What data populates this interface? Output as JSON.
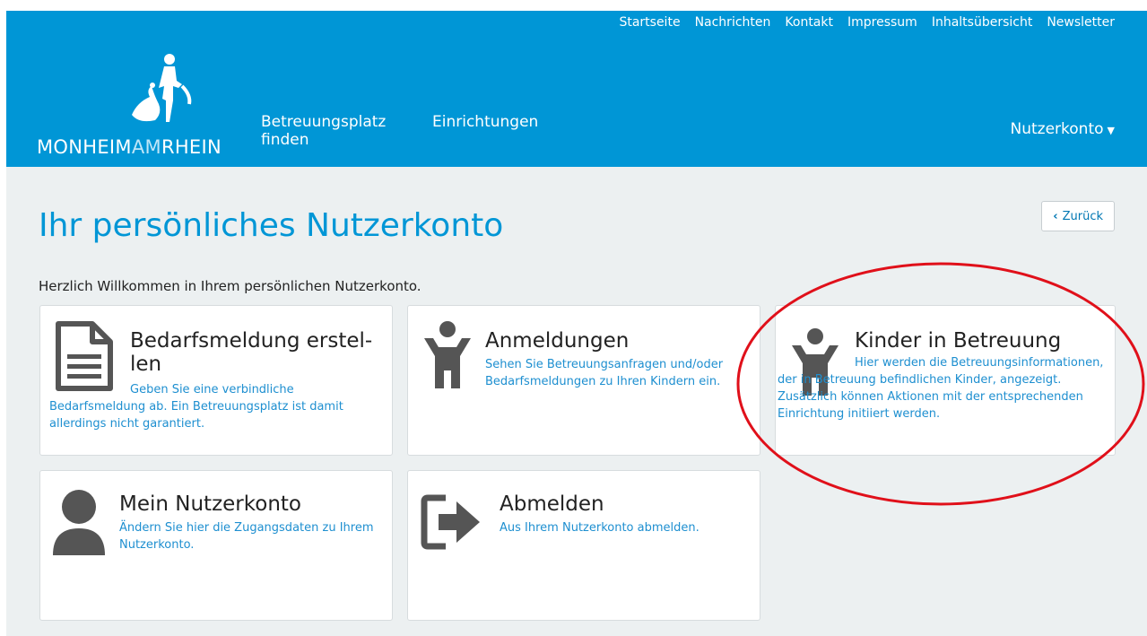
{
  "topnav": [
    "Startseite",
    "Nachrichten",
    "Kontakt",
    "Impressum",
    "Inhaltsübersicht",
    "Newsletter"
  ],
  "logo": {
    "part1": "MONHEIM",
    "part2": "AM",
    "part3": "RHEIN"
  },
  "mainnav": {
    "item1": "Betreuungsplatz finden",
    "item2": "Einrichtungen"
  },
  "account": {
    "label": "Nutzerkonto"
  },
  "page": {
    "title": "Ihr persönliches Nutzerkonto",
    "back": "Zurück",
    "welcome": "Herzlich Willkommen in Ihrem persönlichen Nutzerkonto."
  },
  "cards": [
    {
      "title": "Bedarfsmeldung erstel-\nlen",
      "desc": "Geben Sie eine verbindliche Bedarfsmeldung ab. Ein Betreuungsplatz ist damit allerdings nicht garantiert.",
      "icon": "document-icon"
    },
    {
      "title": "Anmeldungen",
      "desc": "Sehen Sie Betreuungsanfragen und/oder Bedarfsmeldungen zu Ihren Kindern ein.",
      "icon": "child-icon"
    },
    {
      "title": "Kinder in Betreuung",
      "desc": "Hier werden die Betreuungsinformationen, der in Betreuung befindlichen Kinder, angezeigt. Zusätzlich können Aktionen mit der entsprechenden Einrichtung initiiert werden.",
      "icon": "child-icon"
    },
    {
      "title": "Mein Nutzerkonto",
      "desc": "Ändern Sie hier die Zugangsdaten zu Ihrem Nutzerkonto.",
      "icon": "user-icon"
    },
    {
      "title": "Abmelden",
      "desc": "Aus Ihrem Nutzerkonto abmelden.",
      "icon": "logout-icon"
    }
  ],
  "colors": {
    "brand": "#0096d6",
    "link": "#1e8fd0",
    "background": "#ecf0f1",
    "annotation": "#e0101a"
  }
}
